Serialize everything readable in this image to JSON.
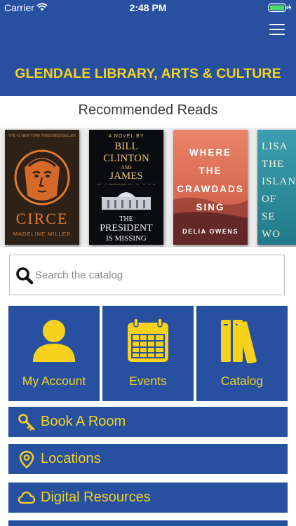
{
  "status_bar": {
    "carrier": "Carrier",
    "time": "2:48 PM",
    "battery_level": 1.0,
    "icons": [
      "wifi-icon",
      "battery-icon"
    ]
  },
  "header": {
    "title": "GLENDALE LIBRARY, ARTS & CULTURE",
    "menu_icon": "hamburger-menu-icon",
    "background_color": "#2751a0",
    "title_color": "#f6d21c"
  },
  "recommended": {
    "heading": "Recommended Reads",
    "books": [
      {
        "title": "CIRCE",
        "author": "MADELINE MILLER",
        "tagline": "THE #1 NEW YORK TIMES BESTSELLER"
      },
      {
        "prefix": "A NOVEL BY",
        "author_line1": "BILL",
        "author_line2": "CLINTON",
        "and": "AND",
        "author_line3": "JAMES",
        "author_line4": "PATTERSON",
        "title_line1": "THE",
        "title_line2": "PRESIDENT",
        "title_line3": "IS MISSING"
      },
      {
        "title_line1": "WHERE",
        "title_line2": "THE",
        "title_line3": "CRAWDADS",
        "title_line4": "SING",
        "author": "DELIA OWENS"
      },
      {
        "title": "LISA\nTHE\nISLAN\nOF\nSE\nWO"
      }
    ]
  },
  "search": {
    "placeholder": "Search the catalog",
    "value": "",
    "icon": "search-icon"
  },
  "tiles": [
    {
      "label": "My Account",
      "icon": "user-icon"
    },
    {
      "label": "Events",
      "icon": "calendar-icon"
    },
    {
      "label": "Catalog",
      "icon": "books-icon"
    }
  ],
  "menu_rows": [
    {
      "label": "Book A Room",
      "icon": "key-icon"
    },
    {
      "label": "Locations",
      "icon": "map-pin-icon"
    },
    {
      "label": "Digital Resources",
      "icon": "cloud-icon"
    },
    {
      "label": "",
      "icon": ""
    }
  ],
  "colors": {
    "brand_blue": "#2751a0",
    "accent_yellow": "#f6d21c"
  }
}
